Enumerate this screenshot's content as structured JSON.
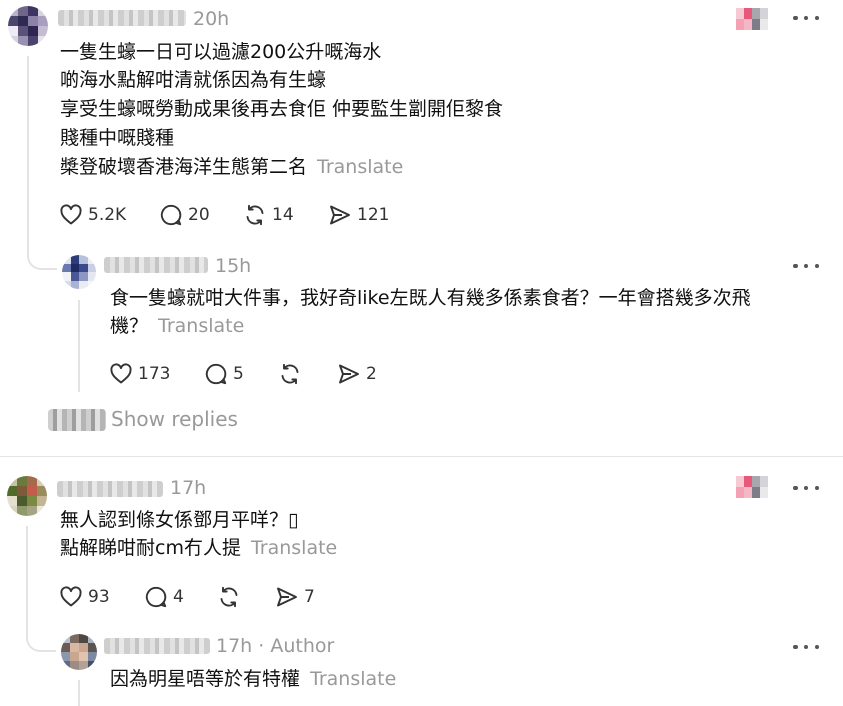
{
  "colors": {
    "muted": "#999999",
    "text": "#111111",
    "line": "#e3e3e3",
    "icon": "#333333"
  },
  "posts": [
    {
      "time": "20h",
      "lines": [
        "一隻生蠔一日可以過濾200公升嘅海水",
        "啲海水點解咁清就係因為有生蠔",
        "享受生蠔嘅勞動成果後再去食佢 仲要監生劏開佢黎食",
        "賤種中嘅賤種"
      ],
      "last_line": "槳登破壞香港海洋生態第二名",
      "translate": "Translate",
      "likes": "5.2K",
      "comments": "20",
      "reposts": "14",
      "shares": "121"
    },
    {
      "time": "15h",
      "lines": [
        "食一隻蠔就咁大件事，我好奇like左既人有幾多係素食者？一年會搭幾多次飛"
      ],
      "last_line": "機？",
      "translate": "Translate",
      "likes": "173",
      "comments": "5",
      "reposts": "",
      "shares": "2"
    },
    {
      "time": "17h",
      "lines": [
        "無人認到條女係鄧月平咩？▯"
      ],
      "last_line": "點解睇咁耐cm冇人提",
      "translate": "Translate",
      "likes": "93",
      "comments": "4",
      "reposts": "",
      "shares": "7"
    },
    {
      "time": "17h",
      "author_tag": "· Author",
      "lines": [],
      "last_line": "因為明星唔等於有特權",
      "translate": "Translate"
    }
  ],
  "show_replies": "Show replies",
  "icons": [
    "heart-icon",
    "comment-icon",
    "repost-icon",
    "share-icon",
    "more-icon"
  ]
}
